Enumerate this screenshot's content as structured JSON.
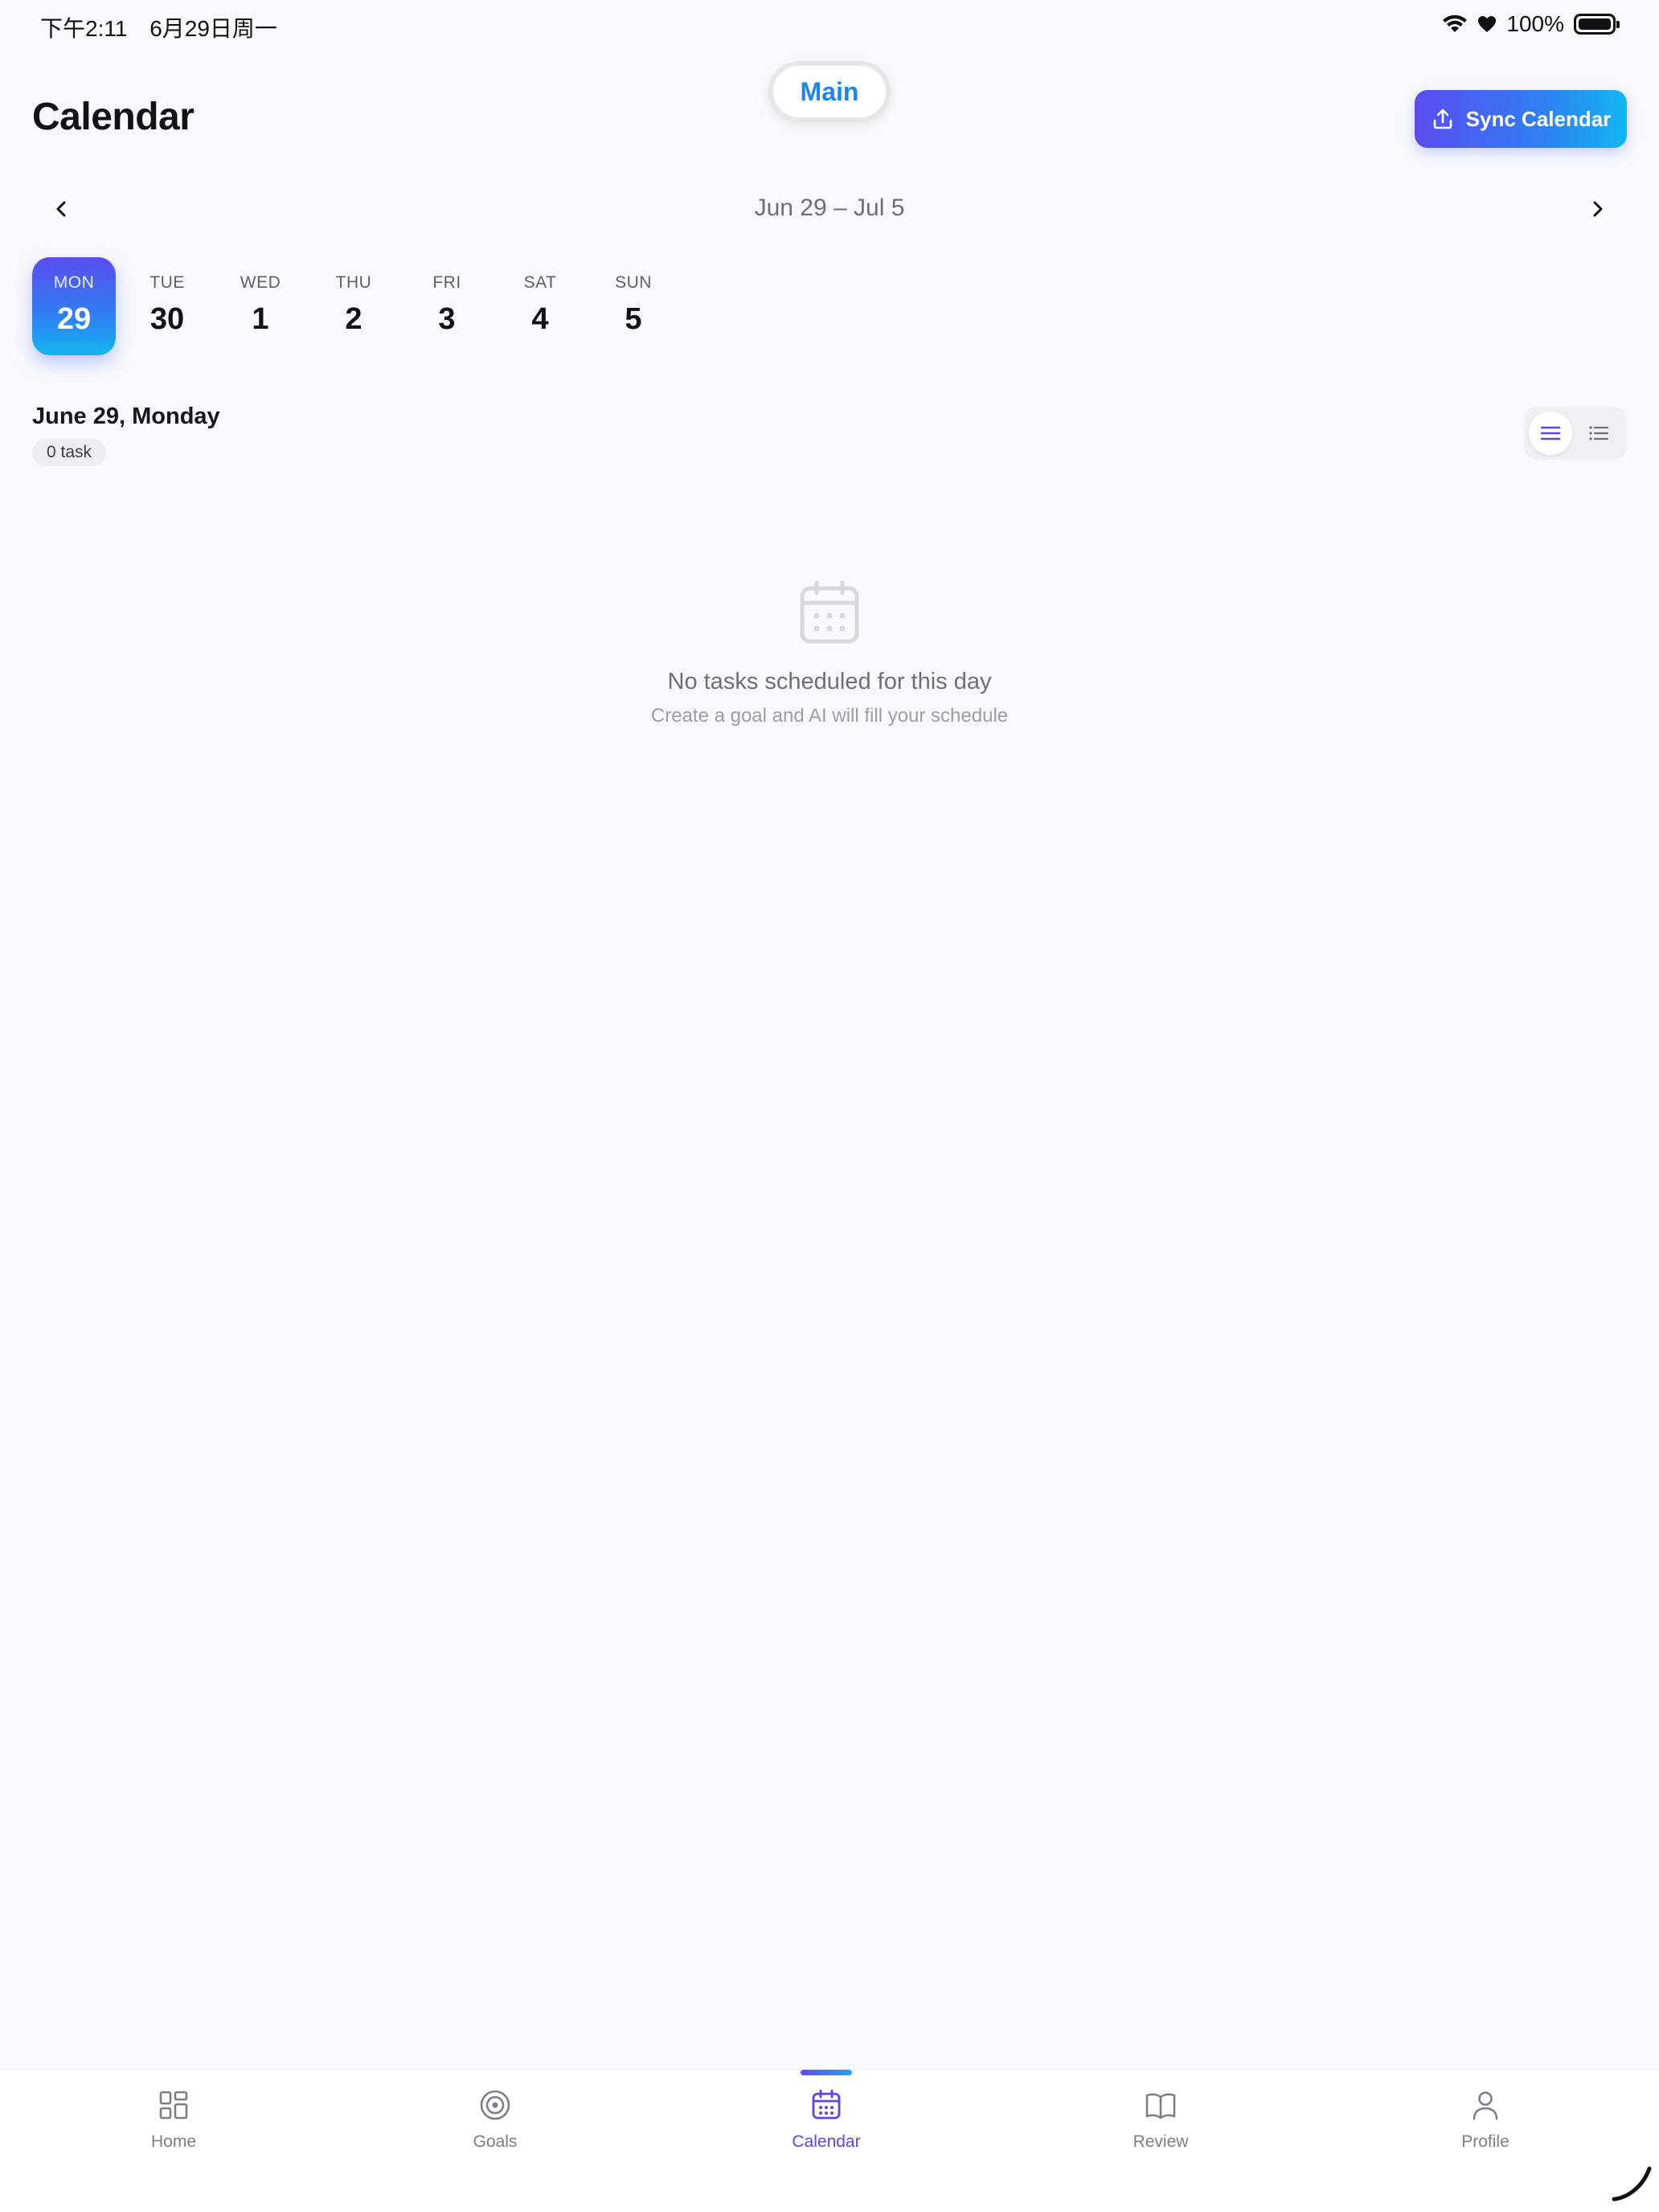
{
  "status_bar": {
    "time": "下午2:11",
    "date": "6月29日周一",
    "battery": "100%"
  },
  "header": {
    "title": "Calendar",
    "pill_label": "Main",
    "sync_label": "Sync Calendar"
  },
  "week": {
    "range": "Jun 29 – Jul 5",
    "days": [
      {
        "dow": "MON",
        "num": "29",
        "selected": true
      },
      {
        "dow": "TUE",
        "num": "30"
      },
      {
        "dow": "WED",
        "num": "1"
      },
      {
        "dow": "THU",
        "num": "2"
      },
      {
        "dow": "FRI",
        "num": "3"
      },
      {
        "dow": "SAT",
        "num": "4"
      },
      {
        "dow": "SUN",
        "num": "5"
      }
    ]
  },
  "day_view": {
    "heading": "June 29, Monday",
    "task_count": "0 task"
  },
  "empty_state": {
    "title": "No tasks scheduled for this day",
    "subtitle": "Create a goal and AI will fill your schedule"
  },
  "tabs": [
    {
      "label": "Home",
      "icon": "grid-icon"
    },
    {
      "label": "Goals",
      "icon": "target-icon"
    },
    {
      "label": "Calendar",
      "icon": "calendar-icon",
      "active": true
    },
    {
      "label": "Review",
      "icon": "book-icon"
    },
    {
      "label": "Profile",
      "icon": "person-icon"
    }
  ],
  "colors": {
    "accent": "#5b46e0",
    "gradient_start": "#5b4cf0",
    "gradient_end": "#13b6f0",
    "pill_text": "#1a86e8"
  }
}
